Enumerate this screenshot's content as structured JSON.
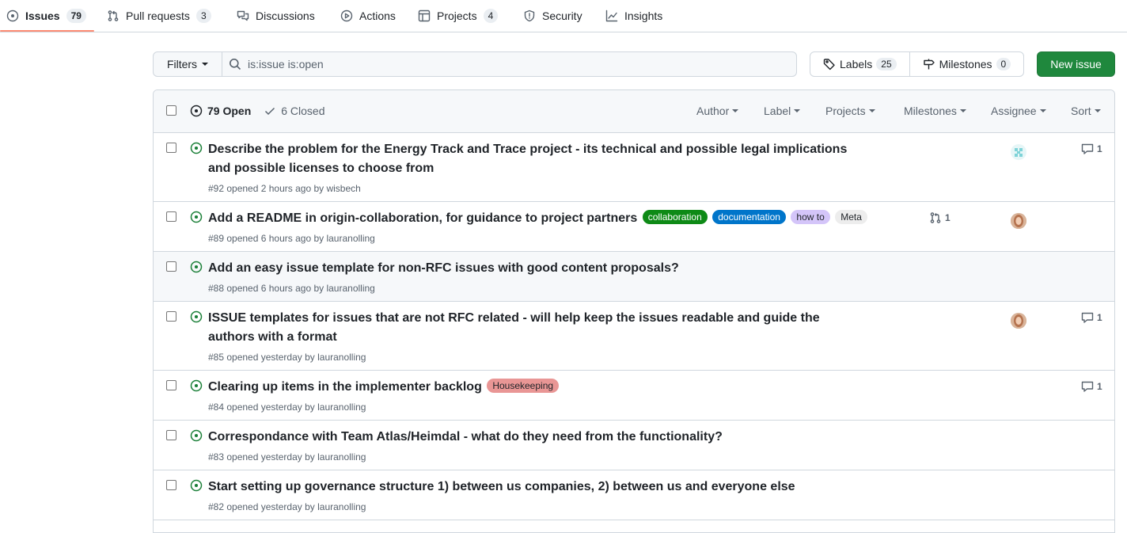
{
  "nav": {
    "issues": {
      "label": "Issues",
      "count": "79"
    },
    "pulls": {
      "label": "Pull requests",
      "count": "3"
    },
    "discussions": {
      "label": "Discussions"
    },
    "actions": {
      "label": "Actions"
    },
    "projects": {
      "label": "Projects",
      "count": "4"
    },
    "security": {
      "label": "Security"
    },
    "insights": {
      "label": "Insights"
    }
  },
  "toolbar": {
    "filters_label": "Filters",
    "search_value": "is:issue is:open",
    "labels_label": "Labels",
    "labels_count": "25",
    "milestones_label": "Milestones",
    "milestones_count": "0",
    "new_issue_label": "New issue"
  },
  "header": {
    "open_label": "79 Open",
    "closed_label": "6 Closed",
    "filters": [
      "Author",
      "Label",
      "Projects",
      "Milestones",
      "Assignee",
      "Sort"
    ]
  },
  "issues": [
    {
      "title": "Describe the problem for the Energy Track and Trace project - its technical and possible legal implications and possible licenses to choose from",
      "meta": "#92 opened 2 hours ago by wisbech",
      "labels": [],
      "comments": "1",
      "avatar": "wisbech-avatar"
    },
    {
      "title": "Add a README in origin-collaboration, for guidance to project partners",
      "meta": "#89 opened 6 hours ago by lauranolling",
      "labels": [
        {
          "name": "collaboration",
          "bg": "#0e8a16",
          "fg": "#ffffff"
        },
        {
          "name": "documentation",
          "bg": "#0075ca",
          "fg": "#ffffff"
        },
        {
          "name": "how to",
          "bg": "#d4c5f9",
          "fg": "#1f2328"
        },
        {
          "name": "Meta",
          "bg": "#ededed",
          "fg": "#1f2328"
        }
      ],
      "linked_prs": "1",
      "avatar": "lauranolling-avatar"
    },
    {
      "title": "Add an easy issue template for non-RFC issues with good content proposals?",
      "meta": "#88 opened 6 hours ago by lauranolling",
      "labels": []
    },
    {
      "title": "ISSUE templates for issues that are not RFC related - will help keep the issues readable and guide the authors with a format",
      "meta": "#85 opened yesterday by lauranolling",
      "labels": [],
      "comments": "1",
      "avatar": "lauranolling-avatar"
    },
    {
      "title": "Clearing up items in the implementer backlog",
      "meta": "#84 opened yesterday by lauranolling",
      "labels": [
        {
          "name": "Housekeeping",
          "bg": "#e99695",
          "fg": "#1f2328"
        }
      ],
      "comments": "1"
    },
    {
      "title": "Correspondance with Team Atlas/Heimdal - what do they need from the functionality?",
      "meta": "#83 opened yesterday by lauranolling",
      "labels": []
    },
    {
      "title": "Start setting up governance structure 1) between us companies, 2) between us and everyone else",
      "meta": "#82 opened yesterday by lauranolling",
      "labels": []
    }
  ],
  "colors": {
    "open_green": "#1a7f37",
    "accent_underline": "#fd8c73",
    "primary_button": "#1f883d",
    "border": "#d0d7de",
    "muted_text": "#59636e"
  }
}
